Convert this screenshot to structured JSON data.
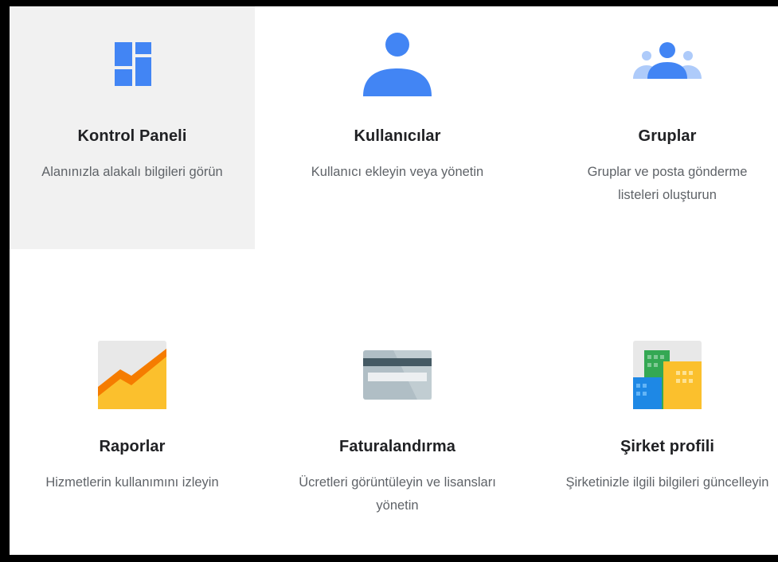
{
  "tiles": [
    {
      "title": "Kontrol Paneli",
      "description": "Alanınızla alakalı bilgileri görün",
      "icon": "dashboard-icon"
    },
    {
      "title": "Kullanıcılar",
      "description": "Kullanıcı ekleyin veya yönetin",
      "icon": "person-icon"
    },
    {
      "title": "Gruplar",
      "description": "Gruplar ve posta gönderme listeleri oluşturun",
      "icon": "groups-icon"
    },
    {
      "title": "Raporlar",
      "description": "Hizmetlerin kullanımını izleyin",
      "icon": "reports-chart-icon"
    },
    {
      "title": "Faturalandırma",
      "description": "Ücretleri görüntüleyin ve lisansları yönetin",
      "icon": "credit-card-icon"
    },
    {
      "title": "Şirket profili",
      "description": "Şirketinizle ilgili bilgileri güncelleyin",
      "icon": "company-buildings-icon"
    }
  ],
  "colors": {
    "primary_blue": "#4285f4",
    "light_blue": "#aecbfa",
    "tile_active_bg": "#f1f1f1",
    "title_text": "#202124",
    "desc_text": "#5f6368"
  }
}
